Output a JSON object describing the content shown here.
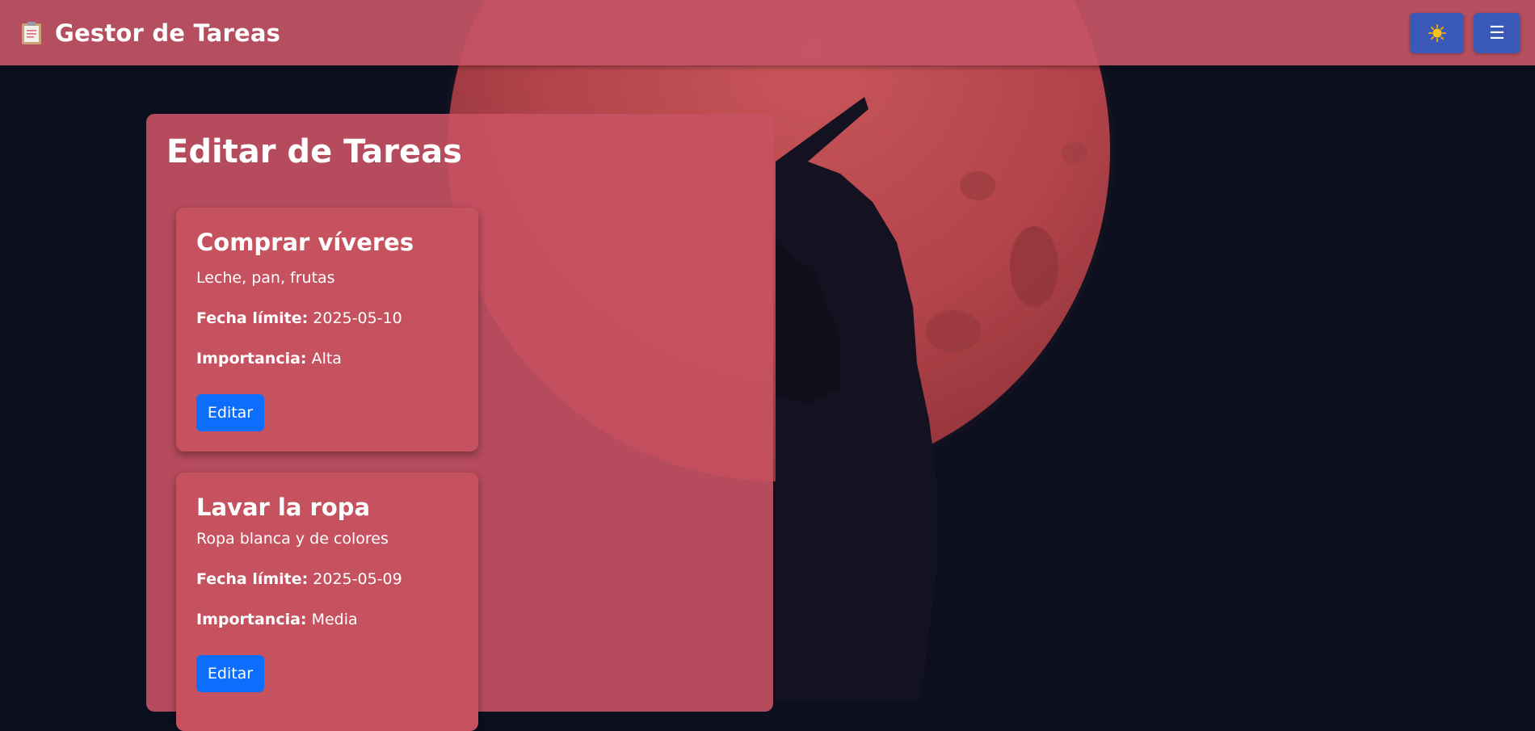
{
  "header": {
    "app_icon": "clipboard-icon",
    "app_title": "Gestor de Tareas",
    "theme_button_icon": "sun-icon",
    "menu_button_icon": "hamburger-menu-icon"
  },
  "main": {
    "title": "Editar de Tareas",
    "tasks": [
      {
        "title": "Comprar víveres",
        "description": "Leche, pan, frutas",
        "due_label": "Fecha límite:",
        "due_value": "2025-05-10",
        "importance_label": "Importancia:",
        "importance_value": "Alta",
        "edit_label": "Editar"
      },
      {
        "title": "Lavar la ropa",
        "description": "Ropa blanca y de colores",
        "due_label": "Fecha límite:",
        "due_value": "2025-05-09",
        "importance_label": "Importancia:",
        "importance_value": "Media",
        "edit_label": "Editar"
      }
    ]
  },
  "colors": {
    "header_bg": "#c45465",
    "panel_bg": "#c85263",
    "card_bg": "#c6525f",
    "edit_button": "#0d6efd",
    "header_button": "#3b59b6",
    "background": "#0b0f1e",
    "moon": "#b8474c"
  }
}
